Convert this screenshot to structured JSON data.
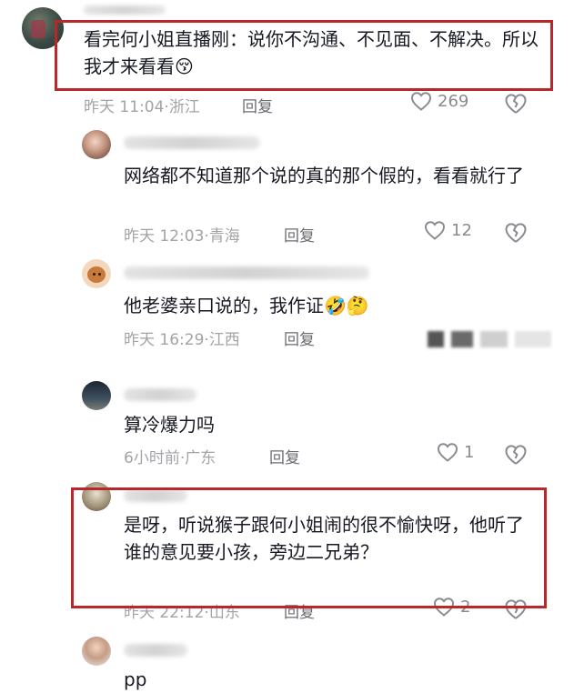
{
  "comments": [
    {
      "text": "看完何小姐直播刚：说你不沟通、不见面、不解决。所以我才来看看😚",
      "time": "昨天 11:04",
      "location": "浙江",
      "reply_label": "回复",
      "likes": "269",
      "highlighted": true
    },
    {
      "text": "网络都不知道那个说的真的那个假的，看看就行了",
      "time": "昨天 12:03",
      "location": "青海",
      "reply_label": "回复",
      "likes": "12"
    },
    {
      "text": "他老婆亲口说的，我作证🤣🤔",
      "time": "昨天 16:29",
      "location": "江西",
      "reply_label": "回复",
      "likes": ""
    },
    {
      "text": "算冷爆力吗",
      "time": "6小时前",
      "location": "广东",
      "reply_label": "回复",
      "likes": "1"
    },
    {
      "text": "是呀，听说猴子跟何小姐闹的很不愉快呀，他听了谁的意见要小孩，旁边二兄弟？",
      "time": "昨天 22:12",
      "location": "山东",
      "reply_label": "回复",
      "likes": "2",
      "highlighted": true
    },
    {
      "text": "pp"
    }
  ],
  "icons": {
    "like": "heart-outline-icon",
    "dislike": "broken-heart-icon"
  },
  "colors": {
    "highlight_box": "#b8282a",
    "meta_text": "#a3a3a8"
  }
}
